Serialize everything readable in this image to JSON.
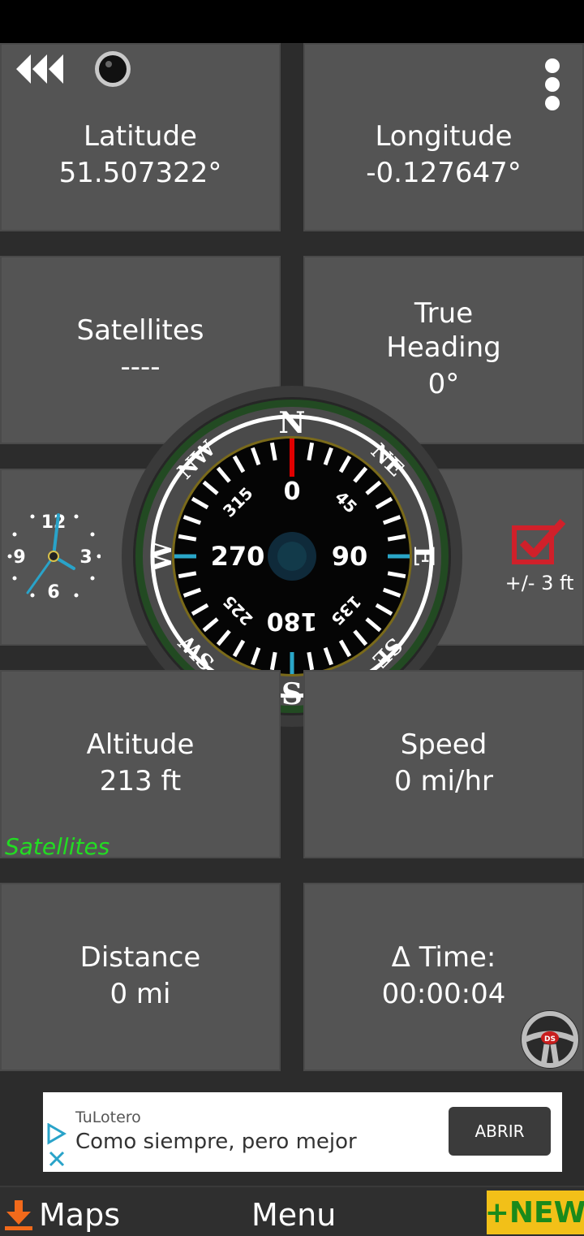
{
  "tiles": {
    "latitude": {
      "label": "Latitude",
      "value": "51.507322°"
    },
    "longitude": {
      "label": "Longitude",
      "value": "-0.127647°"
    },
    "satellites": {
      "label": "Satellites",
      "value": "----"
    },
    "true_heading": {
      "label_line1": "True",
      "label_line2": "Heading",
      "value": "0°"
    },
    "altitude": {
      "label": "Altitude",
      "value": "213 ft"
    },
    "speed": {
      "label": "Speed",
      "value": "0 mi/hr"
    },
    "distance": {
      "label": "Distance",
      "value": "0 mi"
    },
    "delta_time": {
      "label": "Δ Time:",
      "value": "00:00:04"
    }
  },
  "satellites_link": "Satellites",
  "accuracy": "+/- 3 ft",
  "clock": {
    "n12": "12",
    "n3": "3",
    "n6": "6",
    "n9": "9"
  },
  "compass": {
    "cardinals": {
      "n": "N",
      "e": "E",
      "s": "S",
      "w": "W",
      "ne": "NE",
      "nw": "NW",
      "se": "SE",
      "sw": "SW"
    },
    "degrees": {
      "d0": "0",
      "d90": "90",
      "d180": "180",
      "d270": "270",
      "d45": "45",
      "d135": "135",
      "d225": "225",
      "d315": "315"
    },
    "heading_deg": 0
  },
  "steering_badge": "DS",
  "ad": {
    "brand": "TuLotero",
    "text": "Como siempre, pero mejor",
    "button": "ABRIR"
  },
  "bottom": {
    "maps": "Maps",
    "menu": "Menu",
    "new": "+NEW"
  },
  "colors": {
    "tile": "#545454",
    "satellites_link": "#22dd22",
    "new_bg": "#f2c018",
    "new_text": "#1b8a1b",
    "needle": "#e00000"
  }
}
